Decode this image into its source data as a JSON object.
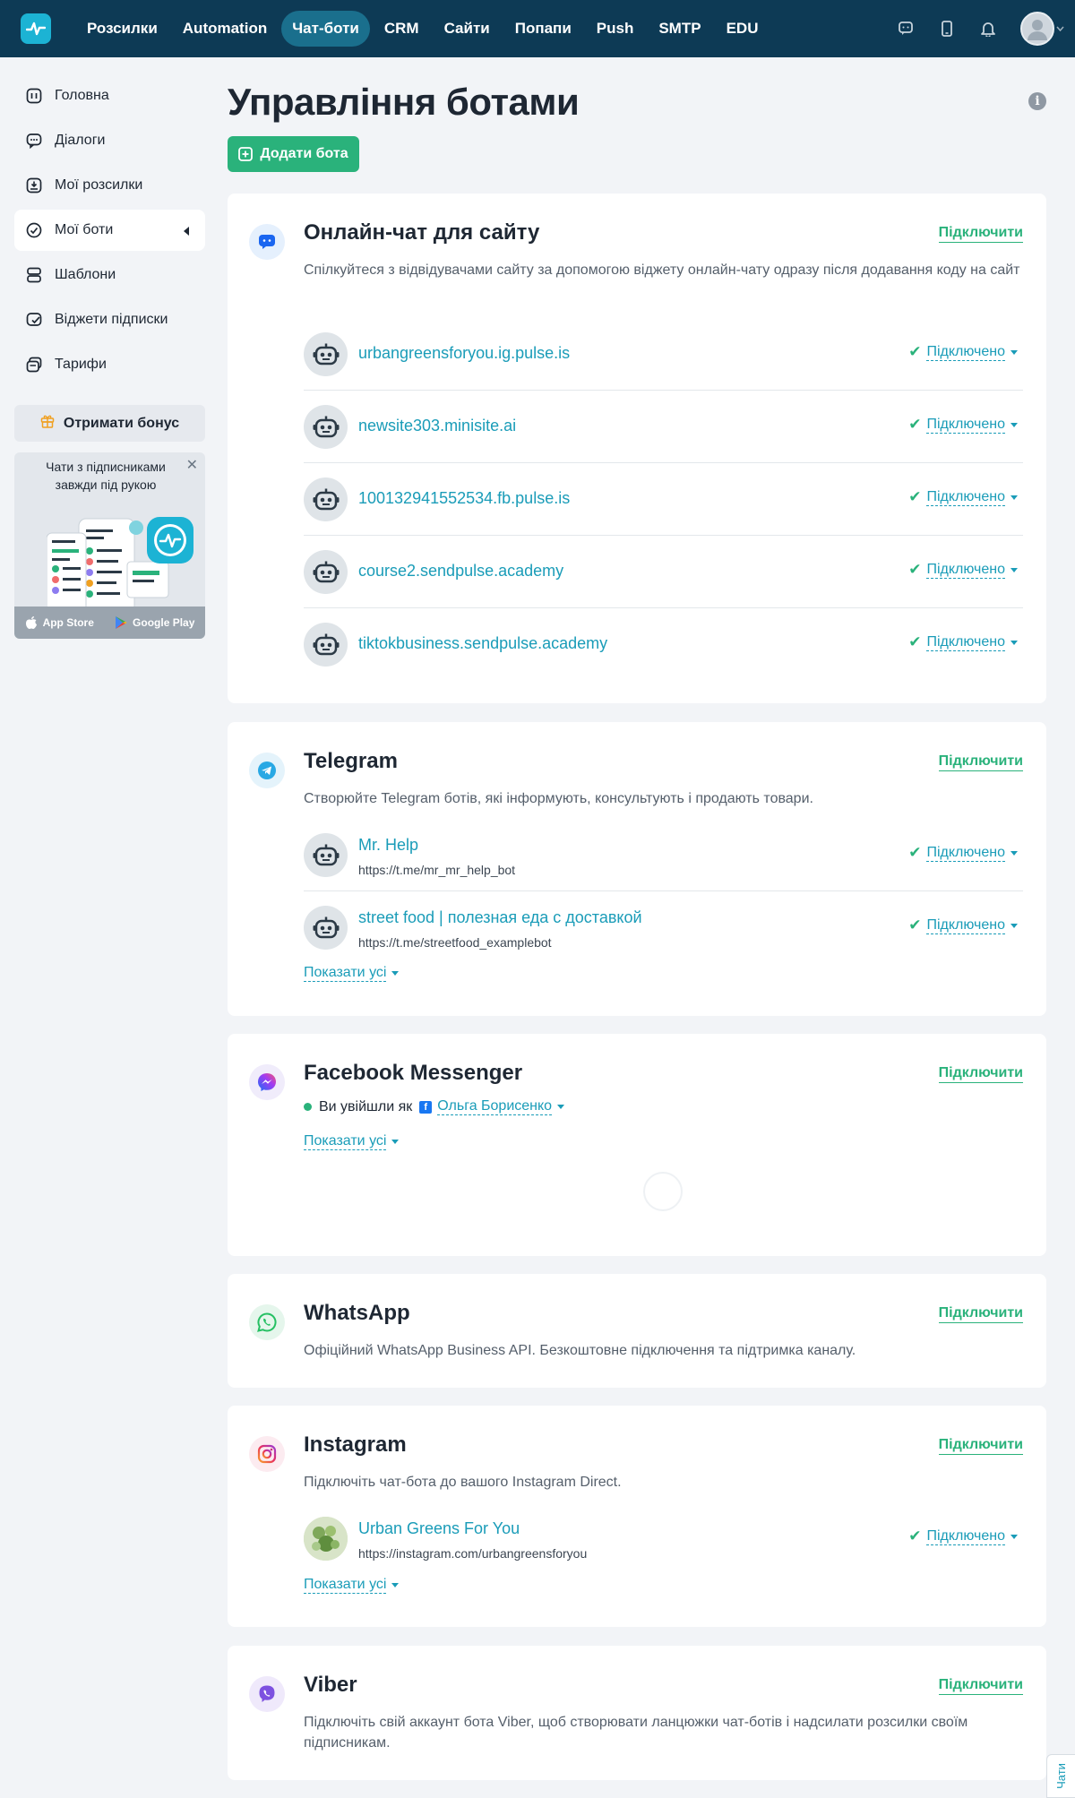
{
  "nav": {
    "items": [
      {
        "label": "Розсилки",
        "active": false
      },
      {
        "label": "Automation",
        "active": false
      },
      {
        "label": "Чат-боти",
        "active": true
      },
      {
        "label": "CRM",
        "active": false
      },
      {
        "label": "Сайти",
        "active": false
      },
      {
        "label": "Попапи",
        "active": false
      },
      {
        "label": "Push",
        "active": false
      },
      {
        "label": "SMTP",
        "active": false
      },
      {
        "label": "EDU",
        "active": false
      }
    ]
  },
  "sidebar": {
    "items": [
      {
        "label": "Головна",
        "icon": "home-icon"
      },
      {
        "label": "Діалоги",
        "icon": "chat-bubble-icon"
      },
      {
        "label": "Мої розсилки",
        "icon": "inbox-icon"
      },
      {
        "label": "Мої боти",
        "icon": "bot-icon",
        "active": true
      },
      {
        "label": "Шаблони",
        "icon": "templates-icon"
      },
      {
        "label": "Віджети підписки",
        "icon": "widget-icon"
      },
      {
        "label": "Тарифи",
        "icon": "pricing-icon"
      }
    ],
    "bonus_label": "Отримати бонус",
    "promo": {
      "text": "Чати з підписниками завжди під рукою",
      "app_store": "App Store",
      "google_play": "Google Play"
    }
  },
  "page": {
    "title": "Управління ботами",
    "add_bot_label": "Додати бота"
  },
  "cards": {
    "connect_label": "Підключити",
    "connected_label": "Підключено",
    "show_all_label": "Показати усі",
    "livechat": {
      "title": "Онлайн-чат для сайту",
      "description": "Спілкуйтеся з відвідувачами сайту за допомогою віджету онлайн-чату одразу після додавання коду на сайт",
      "bots": [
        {
          "name": "urbangreensforyou.ig.pulse.is"
        },
        {
          "name": "newsite303.minisite.ai"
        },
        {
          "name": "100132941552534.fb.pulse.is"
        },
        {
          "name": "course2.sendpulse.academy"
        },
        {
          "name": "tiktokbusiness.sendpulse.academy"
        }
      ]
    },
    "telegram": {
      "title": "Telegram",
      "description": "Створюйте Telegram ботів, які інформують, консультують і продають товари.",
      "bots": [
        {
          "name": "Mr. Help",
          "url": "https://t.me/mr_mr_help_bot"
        },
        {
          "name": "street food | полезная еда с доставкой",
          "url": "https://t.me/streetfood_examplebot"
        }
      ]
    },
    "facebook": {
      "title": "Facebook Messenger",
      "logged_in_as": "Ви увійшли як",
      "user_name": "Ольга Борисенко"
    },
    "whatsapp": {
      "title": "WhatsApp",
      "description": "Офіційний WhatsApp Business API. Безкоштовне підключення та підтримка каналу."
    },
    "instagram": {
      "title": "Instagram",
      "description": "Підключіть чат-бота до вашого Instagram Direct.",
      "bots": [
        {
          "name": "Urban Greens For You",
          "url": "https://instagram.com/urbangreensforyou"
        }
      ]
    },
    "viber": {
      "title": "Viber",
      "description": "Підключіть свій аккаунт бота Viber, щоб створювати ланцюжки чат-ботів і надсилати розсилки своїм підписникам."
    }
  },
  "chat_tab_label": "Чати",
  "colors": {
    "topbar": "#0d3a55",
    "accent_green": "#2ab27b",
    "link_blue": "#1a9cb8"
  }
}
